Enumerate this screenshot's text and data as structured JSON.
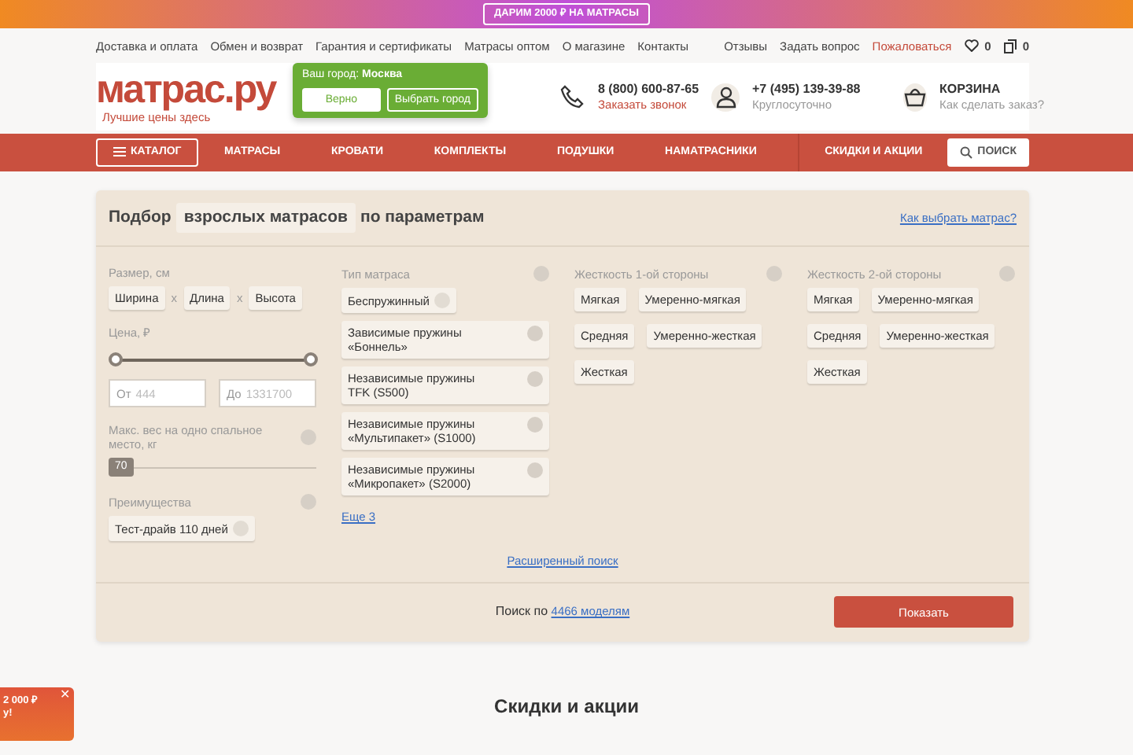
{
  "promo_bar": {
    "text": "ДАРИМ 2000 ₽ НА МАТРАСЫ"
  },
  "top_links": [
    "Доставка и оплата",
    "Обмен и возврат",
    "Гарантия и сертификаты",
    "Матрасы оптом",
    "О магазине",
    "Контакты"
  ],
  "top_right_links": [
    {
      "label": "Отзывы",
      "kind": "plain"
    },
    {
      "label": "Задать вопрос",
      "kind": "plain"
    },
    {
      "label": "Пожаловаться",
      "kind": "accent"
    }
  ],
  "counters": [
    {
      "kind": "heart",
      "count": "0"
    },
    {
      "kind": "compare",
      "count": "0"
    }
  ],
  "header": {
    "logo": "матрас.ру",
    "tagline": "Лучшие цены здесь",
    "city_popup": {
      "label": "Ваш город:",
      "city": "Москва",
      "buttons": [
        {
          "label": "Верно",
          "kind": "light"
        },
        {
          "label": "Выбрать город",
          "kind": "outline"
        }
      ]
    },
    "contacts": [
      {
        "kind": "phone",
        "title": "8 (800) 600-87-65",
        "subtitle": "Заказать звонок"
      },
      {
        "kind": "person",
        "title": "+7 (495) 139-39-88",
        "subtitle": "Круглосуточно"
      },
      {
        "kind": "basket",
        "title": "КОРЗИНА",
        "subtitle": "Как сделать заказ?"
      }
    ]
  },
  "nav": {
    "catalog": "КАТАЛОГ",
    "items": [
      "МАТРАСЫ",
      "КРОВАТИ",
      "КОМПЛЕКТЫ",
      "ПОДУШКИ",
      "НАМАТРАСНИКИ"
    ],
    "sale": "СКИДКИ И АКЦИИ",
    "search": "ПОИСК"
  },
  "filter": {
    "title_before": "Подбор",
    "title_choice": "взрослых матрасов",
    "title_after": "по параметрам",
    "help_link": "Как выбрать матрас?",
    "size": {
      "label": "Размер, см",
      "fields": [
        "Ширина",
        "Длина",
        "Высота"
      ],
      "separators": [
        "x",
        "x"
      ]
    },
    "price": {
      "label": "Цена, ₽",
      "thumbs": [
        {
          "level": 0
        },
        {
          "level": 1
        }
      ],
      "from_prefix": "От",
      "from_placeholder": "444",
      "to_prefix": "До",
      "to_placeholder": "1331700"
    },
    "weight": {
      "label": "Макс. вес на одно спальное место, кг",
      "value": "70",
      "level": 0
    },
    "benefits": {
      "label": "Преимущества",
      "chips": [
        "Тест-драйв 110 дней"
      ]
    },
    "mattress_type": {
      "label": "Тип матраса",
      "options": [
        "Беспружинный",
        "Зависимые пружины «Боннель»",
        "Независимые пружины TFK (S500)",
        "Независимые пружины «Мультипакет» (S1000)",
        "Независимые пружины «Микропакет» (S2000)"
      ],
      "more": "Еще 3"
    },
    "firmness": [
      {
        "label": "Жесткость 1-ой стороны",
        "options": [
          "Мягкая",
          "Умеренно-мягкая",
          "Средняя",
          "Умеренно-жесткая",
          "Жесткая"
        ]
      },
      {
        "label": "Жесткость 2-ой стороны",
        "options": [
          "Мягкая",
          "Умеренно-мягкая",
          "Средняя",
          "Умеренно-жесткая",
          "Жесткая"
        ]
      }
    ],
    "advanced_link": "Расширенный поиск",
    "count_text": "Поиск по",
    "count_link": "4466 моделям",
    "submit": "Показать"
  },
  "section_title": "Скидки и акции",
  "floating_promo": {
    "lines": [
      "2 000 ₽",
      "у!"
    ],
    "close": "✕"
  }
}
